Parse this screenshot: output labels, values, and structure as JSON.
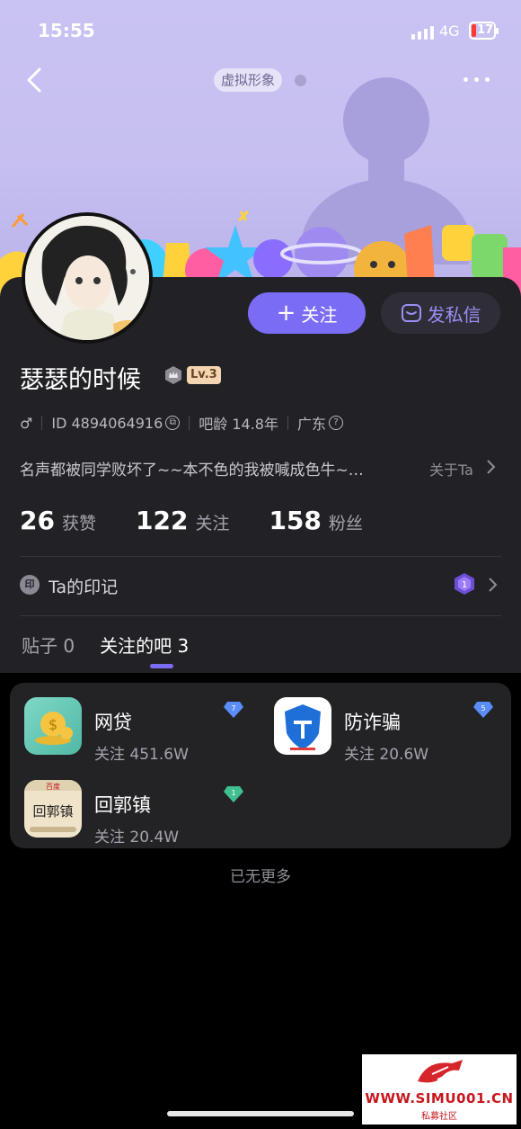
{
  "status_bar": {
    "time": "15:55",
    "network": "4G",
    "battery": "17"
  },
  "header": {
    "avatar_tag": "虚拟形象"
  },
  "profile": {
    "username": "瑟瑟的时候",
    "level": "Lv.3",
    "gender_symbol": "♂",
    "id_text": "ID 4894064916",
    "age_text": "吧龄 14.8年",
    "location": "广东",
    "bio": "名声都被同学败坏了~~本不色的我被喊成色牛~…",
    "about_label": "关于Ta"
  },
  "actions": {
    "follow_label": "关注",
    "message_label": "发私信"
  },
  "stats": [
    {
      "value": "26",
      "label": "获赞"
    },
    {
      "value": "122",
      "label": "关注"
    },
    {
      "value": "158",
      "label": "粉丝"
    }
  ],
  "mark": {
    "icon_char": "印",
    "label": "Ta的印记",
    "badge_number": "1"
  },
  "tabs": [
    {
      "label": "贴子",
      "count": "0"
    },
    {
      "label": "关注的吧",
      "count": "3"
    }
  ],
  "forums": [
    {
      "name": "网贷",
      "followers": "关注 451.6W",
      "level": "7",
      "gem_color": "#5a8df7"
    },
    {
      "name": "防诈骗",
      "followers": "关注 20.6W",
      "level": "5",
      "gem_color": "#5a8df7"
    },
    {
      "name": "回郭镇",
      "followers": "关注 20.4W",
      "level": "1",
      "gem_color": "#3fbf8f"
    }
  ],
  "forum_logo_text": {
    "baidu_top": "百度",
    "name_mark": "回郭镇"
  },
  "footer": {
    "no_more": "已无更多"
  },
  "watermark": {
    "site": "WWW.SIMU001.CN",
    "sub": "私募社区"
  },
  "colors": {
    "accent": "#7b6cf6",
    "card_bg": "#222226",
    "banner": "#c6bff0"
  }
}
